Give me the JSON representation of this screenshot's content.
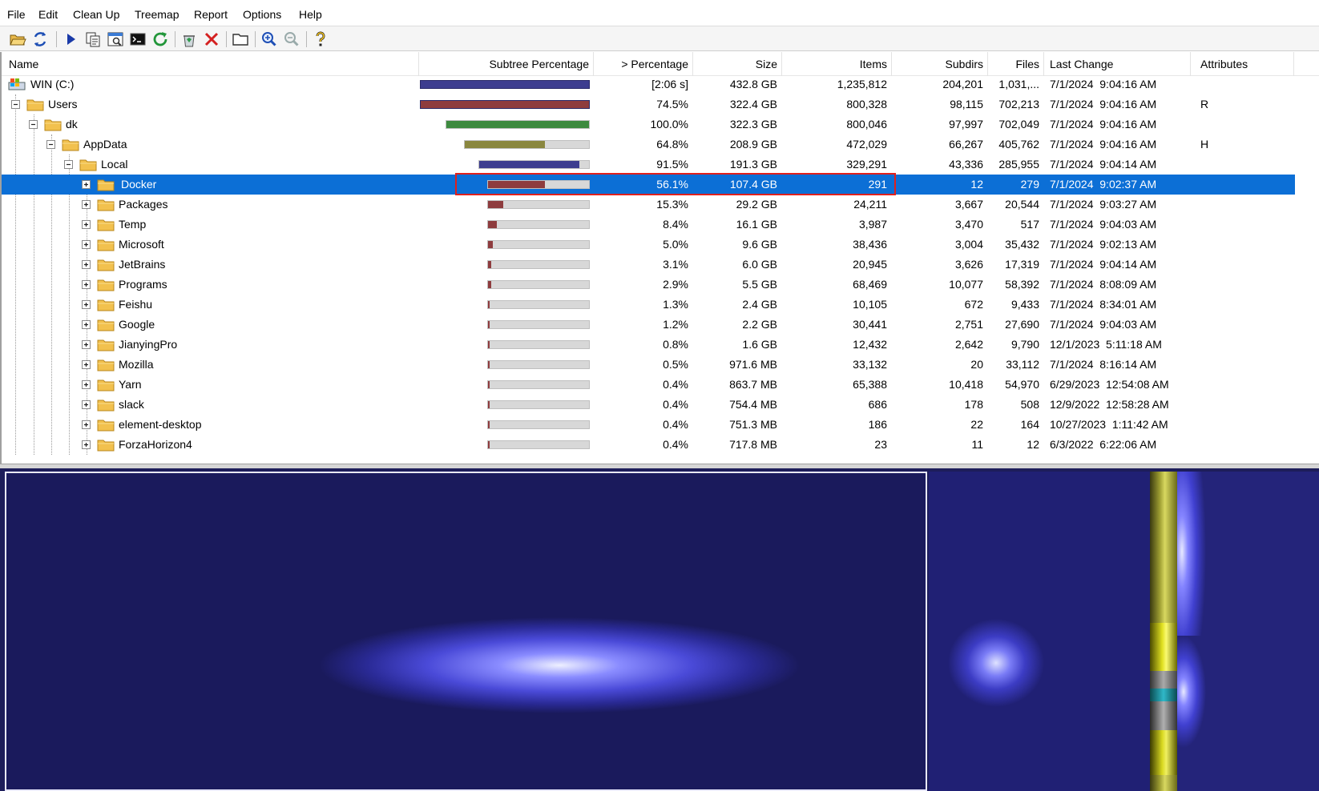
{
  "menu": [
    "File",
    "Edit",
    "Clean Up",
    "Treemap",
    "Report",
    "Options",
    "Help"
  ],
  "toolbar": [
    {
      "name": "open-folder-icon"
    },
    {
      "name": "refresh-icon"
    },
    {
      "name": "play-icon"
    },
    {
      "name": "copy-icon"
    },
    {
      "name": "explorer-icon"
    },
    {
      "name": "command-prompt-icon"
    },
    {
      "name": "refresh-all-icon"
    },
    {
      "name": "recycle-icon"
    },
    {
      "name": "delete-icon"
    },
    {
      "name": "new-folder-icon"
    },
    {
      "name": "zoom-in-icon"
    },
    {
      "name": "zoom-out-icon"
    },
    {
      "name": "help-icon"
    }
  ],
  "columns": {
    "name": "Name",
    "subtree": "Subtree Percentage",
    "percentage": "> Percentage",
    "size": "Size",
    "items": "Items",
    "subdirs": "Subdirs",
    "files": "Files",
    "last_change": "Last Change",
    "attributes": "Attributes"
  },
  "rows": [
    {
      "name": "WIN (C:)",
      "level": 0,
      "icon": "drive",
      "expander": "none",
      "subtree_pct": 100,
      "bar_color": "#3d3d8f",
      "percentage": "[2:06 s]",
      "size": "432.8 GB",
      "items": "1,235,812",
      "subdirs": "204,201",
      "files": "1,031,...",
      "last_change": "7/1/2024  9:04:16 AM",
      "attributes": ""
    },
    {
      "name": "Users",
      "level": 0,
      "icon": "folder",
      "expander": "minus",
      "subtree_pct": 74.5,
      "bar_color": "#8e3c3e",
      "percentage": "74.5%",
      "size": "322.4 GB",
      "items": "800,328",
      "subdirs": "98,115",
      "files": "702,213",
      "last_change": "7/1/2024  9:04:16 AM",
      "attributes": "R"
    },
    {
      "name": "dk",
      "level": 1,
      "icon": "folder",
      "expander": "minus",
      "subtree_pct": 100,
      "bar_color": "#3d8a3f",
      "percentage": "100.0%",
      "size": "322.3 GB",
      "items": "800,046",
      "subdirs": "97,997",
      "files": "702,049",
      "last_change": "7/1/2024  9:04:16 AM",
      "attributes": ""
    },
    {
      "name": "AppData",
      "level": 2,
      "icon": "folder",
      "expander": "minus",
      "subtree_pct": 64.8,
      "bar_color": "#8a873f",
      "percentage": "64.8%",
      "size": "208.9 GB",
      "items": "472,029",
      "subdirs": "66,267",
      "files": "405,762",
      "last_change": "7/1/2024  9:04:16 AM",
      "attributes": "H"
    },
    {
      "name": "Local",
      "level": 3,
      "icon": "folder",
      "expander": "minus",
      "subtree_pct": 91.5,
      "bar_color": "#3d3d8f",
      "percentage": "91.5%",
      "size": "191.3 GB",
      "items": "329,291",
      "subdirs": "43,336",
      "files": "285,955",
      "last_change": "7/1/2024  9:04:14 AM",
      "attributes": ""
    },
    {
      "name": "Docker",
      "level": 4,
      "icon": "folder",
      "expander": "plus",
      "selected": true,
      "subtree_pct": 56.1,
      "bar_color": "#8e3c3e",
      "percentage": "56.1%",
      "size": "107.4 GB",
      "items": "291",
      "subdirs": "12",
      "files": "279",
      "last_change": "7/1/2024  9:02:37 AM",
      "attributes": ""
    },
    {
      "name": "Packages",
      "level": 4,
      "icon": "folder",
      "expander": "plus",
      "subtree_pct": 15.3,
      "bar_color": "#8e3c3e",
      "percentage": "15.3%",
      "size": "29.2 GB",
      "items": "24,211",
      "subdirs": "3,667",
      "files": "20,544",
      "last_change": "7/1/2024  9:03:27 AM",
      "attributes": ""
    },
    {
      "name": "Temp",
      "level": 4,
      "icon": "folder",
      "expander": "plus",
      "subtree_pct": 8.4,
      "bar_color": "#8e3c3e",
      "percentage": "8.4%",
      "size": "16.1 GB",
      "items": "3,987",
      "subdirs": "3,470",
      "files": "517",
      "last_change": "7/1/2024  9:04:03 AM",
      "attributes": ""
    },
    {
      "name": "Microsoft",
      "level": 4,
      "icon": "folder",
      "expander": "plus",
      "subtree_pct": 5.0,
      "bar_color": "#8e3c3e",
      "percentage": "5.0%",
      "size": "9.6 GB",
      "items": "38,436",
      "subdirs": "3,004",
      "files": "35,432",
      "last_change": "7/1/2024  9:02:13 AM",
      "attributes": ""
    },
    {
      "name": "JetBrains",
      "level": 4,
      "icon": "folder",
      "expander": "plus",
      "subtree_pct": 3.1,
      "bar_color": "#8e3c3e",
      "percentage": "3.1%",
      "size": "6.0 GB",
      "items": "20,945",
      "subdirs": "3,626",
      "files": "17,319",
      "last_change": "7/1/2024  9:04:14 AM",
      "attributes": ""
    },
    {
      "name": "Programs",
      "level": 4,
      "icon": "folder",
      "expander": "plus",
      "subtree_pct": 2.9,
      "bar_color": "#8e3c3e",
      "percentage": "2.9%",
      "size": "5.5 GB",
      "items": "68,469",
      "subdirs": "10,077",
      "files": "58,392",
      "last_change": "7/1/2024  8:08:09 AM",
      "attributes": ""
    },
    {
      "name": "Feishu",
      "level": 4,
      "icon": "folder",
      "expander": "plus",
      "subtree_pct": 1.3,
      "bar_color": "#8e3c3e",
      "percentage": "1.3%",
      "size": "2.4 GB",
      "items": "10,105",
      "subdirs": "672",
      "files": "9,433",
      "last_change": "7/1/2024  8:34:01 AM",
      "attributes": ""
    },
    {
      "name": "Google",
      "level": 4,
      "icon": "folder",
      "expander": "plus",
      "subtree_pct": 1.2,
      "bar_color": "#8e3c3e",
      "percentage": "1.2%",
      "size": "2.2 GB",
      "items": "30,441",
      "subdirs": "2,751",
      "files": "27,690",
      "last_change": "7/1/2024  9:04:03 AM",
      "attributes": ""
    },
    {
      "name": "JianyingPro",
      "level": 4,
      "icon": "folder",
      "expander": "plus",
      "subtree_pct": 0.8,
      "bar_color": "#8e3c3e",
      "percentage": "0.8%",
      "size": "1.6 GB",
      "items": "12,432",
      "subdirs": "2,642",
      "files": "9,790",
      "last_change": "12/1/2023  5:11:18 AM",
      "attributes": ""
    },
    {
      "name": "Mozilla",
      "level": 4,
      "icon": "folder",
      "expander": "plus",
      "subtree_pct": 0.5,
      "bar_color": "#8e3c3e",
      "percentage": "0.5%",
      "size": "971.6 MB",
      "items": "33,132",
      "subdirs": "20",
      "files": "33,112",
      "last_change": "7/1/2024  8:16:14 AM",
      "attributes": ""
    },
    {
      "name": "Yarn",
      "level": 4,
      "icon": "folder",
      "expander": "plus",
      "subtree_pct": 0.4,
      "bar_color": "#8e3c3e",
      "percentage": "0.4%",
      "size": "863.7 MB",
      "items": "65,388",
      "subdirs": "10,418",
      "files": "54,970",
      "last_change": "6/29/2023  12:54:08 AM",
      "attributes": ""
    },
    {
      "name": "slack",
      "level": 4,
      "icon": "folder",
      "expander": "plus",
      "subtree_pct": 0.4,
      "bar_color": "#8e3c3e",
      "percentage": "0.4%",
      "size": "754.4 MB",
      "items": "686",
      "subdirs": "178",
      "files": "508",
      "last_change": "12/9/2022  12:58:28 AM",
      "attributes": ""
    },
    {
      "name": "element-desktop",
      "level": 4,
      "icon": "folder",
      "expander": "plus",
      "subtree_pct": 0.4,
      "bar_color": "#8e3c3e",
      "percentage": "0.4%",
      "size": "751.3 MB",
      "items": "186",
      "subdirs": "22",
      "files": "164",
      "last_change": "10/27/2023  1:11:42 AM",
      "attributes": ""
    },
    {
      "name": "ForzaHorizon4",
      "level": 4,
      "icon": "folder",
      "expander": "plus",
      "subtree_pct": 0.4,
      "bar_color": "#8e3c3e",
      "percentage": "0.4%",
      "size": "717.8 MB",
      "items": "23",
      "subdirs": "11",
      "files": "12",
      "last_change": "6/3/2022  6:22:06 AM",
      "attributes": ""
    }
  ],
  "colors": {
    "selection": "#0c6fd6",
    "highlight_box": "#e0201d",
    "folder_yellow": "#f2c14e",
    "treemap_blue": "#5a5ae8",
    "treemap_yellow": "#c8c832",
    "treemap_cyan": "#2fb8c8"
  }
}
